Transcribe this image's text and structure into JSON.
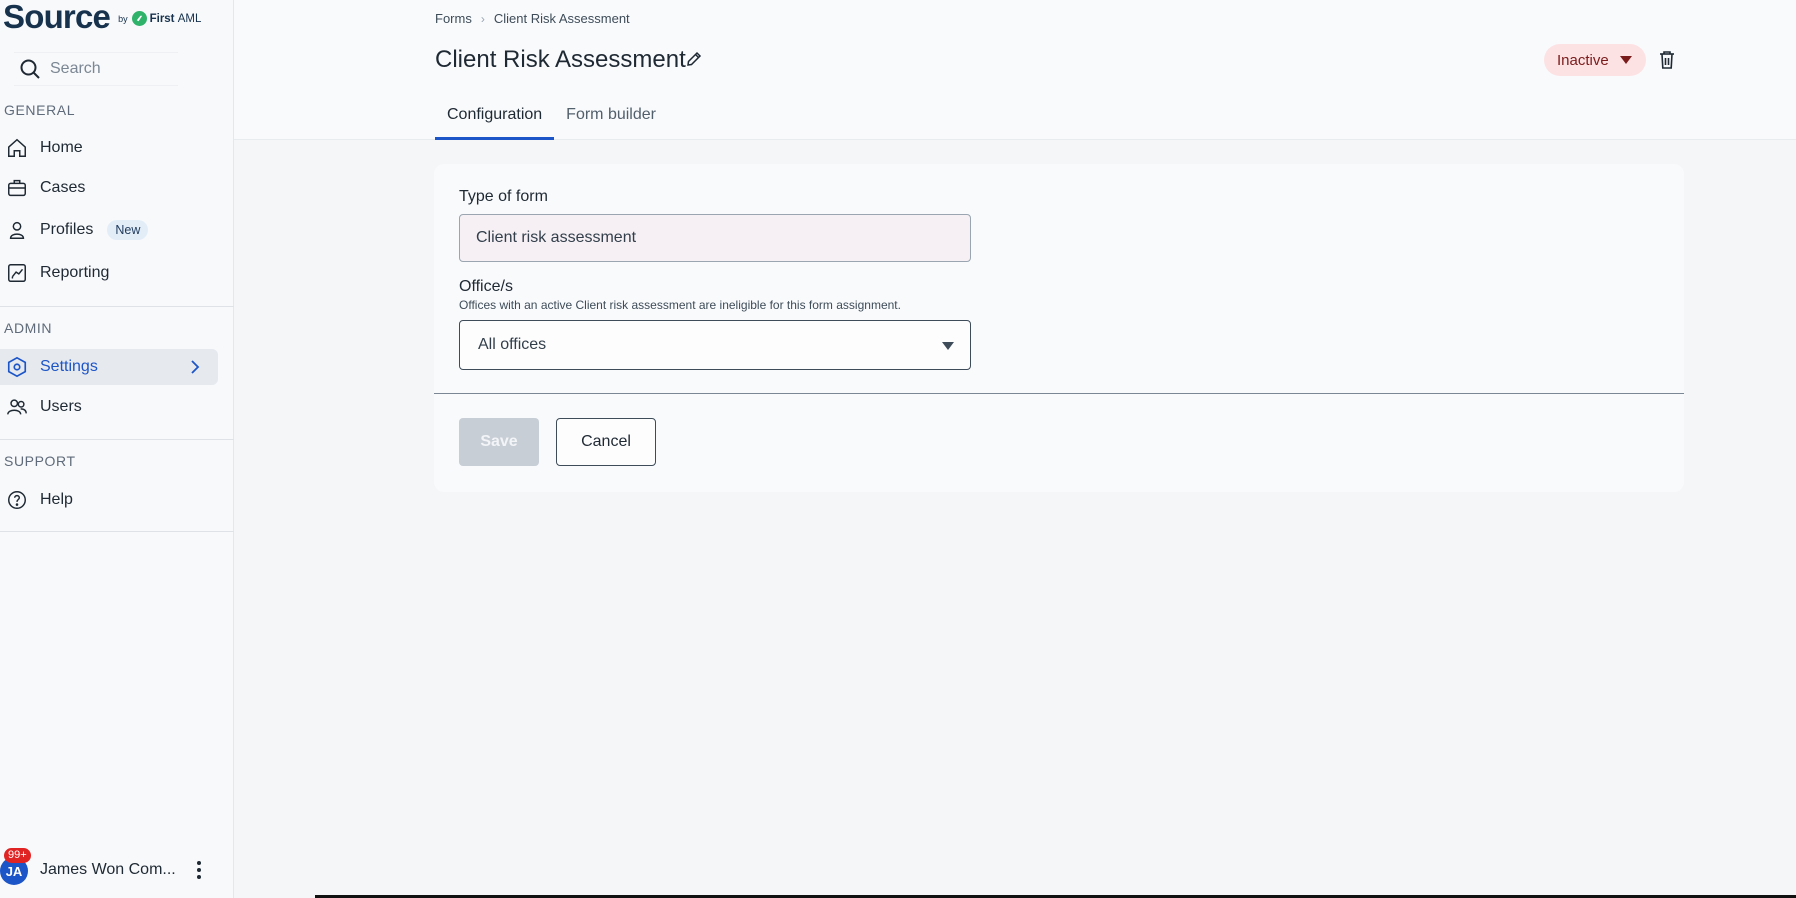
{
  "brand": {
    "name": "Source",
    "by": "by",
    "partner_bold": "First",
    "partner_rest": "AML"
  },
  "search": {
    "placeholder": "Search"
  },
  "sidebar": {
    "sections": {
      "general": "GENERAL",
      "admin": "ADMIN",
      "support": "SUPPORT"
    },
    "items": {
      "home": "Home",
      "cases": "Cases",
      "profiles": "Profiles",
      "profiles_badge": "New",
      "reporting": "Reporting",
      "settings": "Settings",
      "users": "Users",
      "help": "Help"
    },
    "user": {
      "initials": "JA",
      "notifications": "99+",
      "name": "James Won Com..."
    }
  },
  "header": {
    "breadcrumb": [
      "Forms",
      "Client Risk Assessment"
    ],
    "title": "Client Risk Assessment",
    "status": "Inactive",
    "tabs": [
      "Configuration",
      "Form builder"
    ],
    "active_tab": "Configuration"
  },
  "form": {
    "type_label": "Type of form",
    "type_value": "Client risk assessment",
    "offices_label": "Office/s",
    "offices_help": "Offices with an active Client risk assessment are ineligible for this form assignment.",
    "offices_value": "All offices",
    "save_label": "Save",
    "cancel_label": "Cancel"
  },
  "colors": {
    "accent": "#1c55c8",
    "status_bg": "#fde2e4",
    "status_text": "#7a1b1b",
    "brand_logo": "#2fb36b"
  }
}
